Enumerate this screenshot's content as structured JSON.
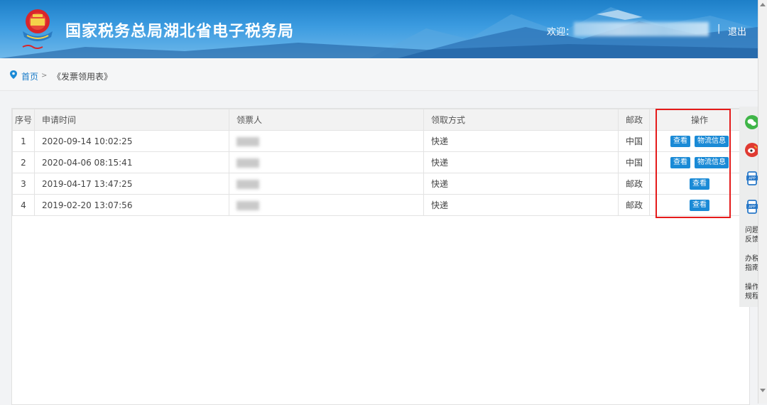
{
  "header": {
    "title": "国家税务总局湖北省电子税务局",
    "welcome_label": "欢迎：",
    "separator": "|",
    "logout_label": "退出"
  },
  "breadcrumb": {
    "home": "首页",
    "arrow": ">",
    "current": "《发票领用表》"
  },
  "table": {
    "columns": [
      "序号",
      "申请时间",
      "领票人",
      "领取方式",
      "邮政",
      "操作"
    ],
    "rows": [
      {
        "seq": "1",
        "time": "2020-09-14 10:02:25",
        "method": "快递",
        "post": "中国",
        "actions": [
          "查看",
          "物流信息"
        ]
      },
      {
        "seq": "2",
        "time": "2020-04-06 08:15:41",
        "method": "快递",
        "post": "中国",
        "actions": [
          "查看",
          "物流信息"
        ]
      },
      {
        "seq": "3",
        "time": "2019-04-17 13:47:25",
        "method": "快递",
        "post": "邮政",
        "actions": [
          "查看"
        ]
      },
      {
        "seq": "4",
        "time": "2019-02-20 13:07:56",
        "method": "快递",
        "post": "邮政",
        "actions": [
          "查看"
        ]
      }
    ]
  },
  "sidebar": {
    "icons": [
      "wechat-icon",
      "weibo-icon",
      "app-icon",
      "app-icon"
    ],
    "items": [
      {
        "label": "问题反馈"
      },
      {
        "label": "办税指南"
      },
      {
        "label": "操作规程"
      }
    ]
  },
  "colors": {
    "header_blue": "#2f8fdb",
    "button_blue": "#1a8ad6",
    "highlight_red": "#e51b1b"
  }
}
